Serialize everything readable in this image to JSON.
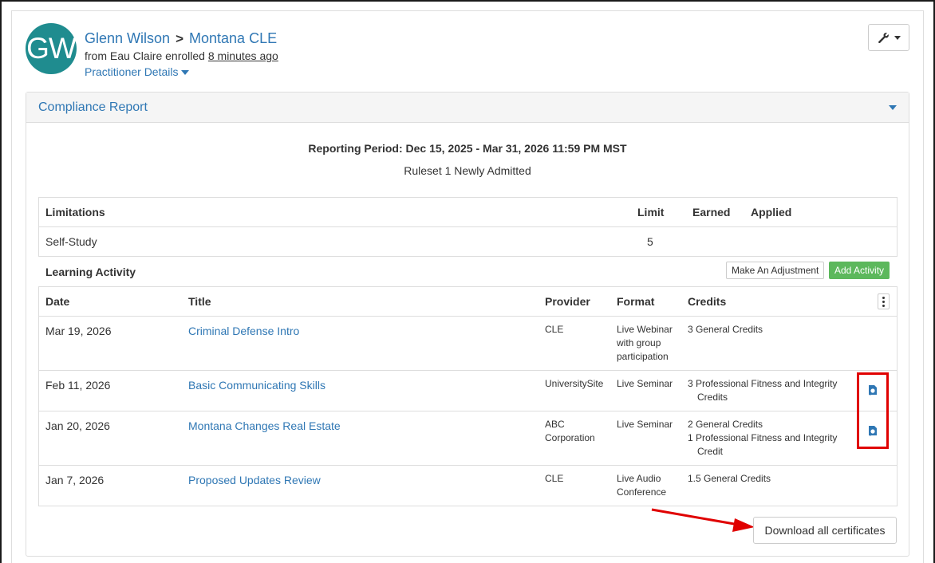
{
  "header": {
    "avatar_initials": "GW",
    "name": "Glenn Wilson",
    "separator": ">",
    "program": "Montana CLE",
    "enroll_prefix": "from Eau Claire enrolled",
    "enrolled_ago": "8 minutes ago",
    "details_label": "Practitioner Details"
  },
  "toolbar": {
    "settings_icon": "wrench-icon"
  },
  "compliance": {
    "title": "Compliance Report",
    "reporting_period": "Reporting Period: Dec 15, 2025 - Mar 31, 2026 11:59 PM MST",
    "ruleset": "Ruleset 1 Newly Admitted"
  },
  "limitations": {
    "headers": {
      "name": "Limitations",
      "limit": "Limit",
      "earned": "Earned",
      "applied": "Applied"
    },
    "rows": [
      {
        "name": "Self-Study",
        "limit": "5",
        "earned": "",
        "applied": ""
      }
    ]
  },
  "learning": {
    "label": "Learning Activity",
    "adjust_button": "Make An Adjustment",
    "add_button": "Add Activity",
    "headers": {
      "date": "Date",
      "title": "Title",
      "provider": "Provider",
      "format": "Format",
      "credits": "Credits"
    },
    "rows": [
      {
        "date": "Mar 19, 2026",
        "title": "Criminal Defense Intro",
        "provider": [
          "CLE"
        ],
        "format": [
          "Live Webinar",
          "with group",
          "participation"
        ],
        "credits": [
          "3 General Credits"
        ],
        "has_certificate": false
      },
      {
        "date": "Feb 11, 2026",
        "title": "Basic Communicating Skills",
        "provider": [
          "UniversitySite"
        ],
        "format": [
          "Live Seminar"
        ],
        "credits": [
          "3 Professional Fitness and Integrity",
          "Credits"
        ],
        "has_certificate": true
      },
      {
        "date": "Jan 20, 2026",
        "title": "Montana Changes Real Estate",
        "provider": [
          "ABC",
          "Corporation"
        ],
        "format": [
          "Live Seminar"
        ],
        "credits": [
          "2 General Credits",
          "1 Professional Fitness and Integrity",
          "Credit"
        ],
        "has_certificate": true
      },
      {
        "date": "Jan 7, 2026",
        "title": "Proposed Updates Review",
        "provider": [
          "CLE"
        ],
        "format": [
          "Live Audio",
          "Conference"
        ],
        "credits": [
          "1.5 General Credits"
        ],
        "has_certificate": false
      }
    ],
    "download_all": "Download all certificates"
  },
  "colors": {
    "link": "#2f77b4",
    "avatar": "#1f8c8f",
    "add_button": "#5cb85c",
    "annotation": "#e00000"
  }
}
